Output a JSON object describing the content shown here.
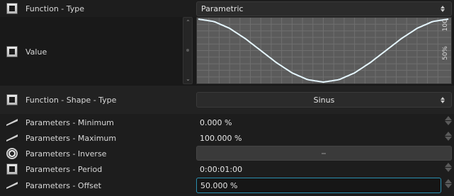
{
  "rows": {
    "function_type": {
      "label": "Function - Type",
      "value": "Parametric"
    },
    "value": {
      "label": "Value",
      "y_axis_top": "100",
      "y_axis_mid": "50%"
    },
    "shape_type": {
      "label": "Function - Shape - Type",
      "value": "Sinus"
    },
    "minimum": {
      "label": "Parameters - Minimum",
      "value": "0.000 %"
    },
    "maximum": {
      "label": "Parameters - Maximum",
      "value": "100.000 %"
    },
    "inverse": {
      "label": "Parameters - Inverse",
      "value": ""
    },
    "period": {
      "label": "Parameters - Period",
      "value": "0:00:01:00"
    },
    "offset": {
      "label": "Parameters - Offset",
      "value": "50.000 %"
    }
  },
  "icons": {
    "checkbox": "checkbox-icon",
    "ramp": "ramp-icon",
    "dial": "dial-icon",
    "spin_up": "spin-up-icon",
    "spin_down": "spin-down-icon",
    "dropdown": "dropdown-arrows-icon"
  },
  "colors": {
    "background": "#1d1d1d",
    "graph_bg": "#5b5b5b",
    "curve": "#e6f7ff",
    "focus_border": "#2a8fb0"
  },
  "chart_data": {
    "type": "line",
    "series": [
      {
        "values_x": [
          0,
          0.0625,
          0.125,
          0.1875,
          0.25,
          0.3125,
          0.375,
          0.4375,
          0.5,
          0.5625,
          0.625,
          0.6875,
          0.75,
          0.8125,
          0.875,
          0.9375,
          1.0
        ],
        "values_y": [
          100,
          96.2,
          85.4,
          69.1,
          50,
          30.9,
          14.6,
          3.8,
          0,
          3.8,
          14.6,
          30.9,
          50,
          69.1,
          85.4,
          96.2,
          100
        ]
      }
    ],
    "ylim": [
      0,
      100
    ],
    "grid": true
  }
}
